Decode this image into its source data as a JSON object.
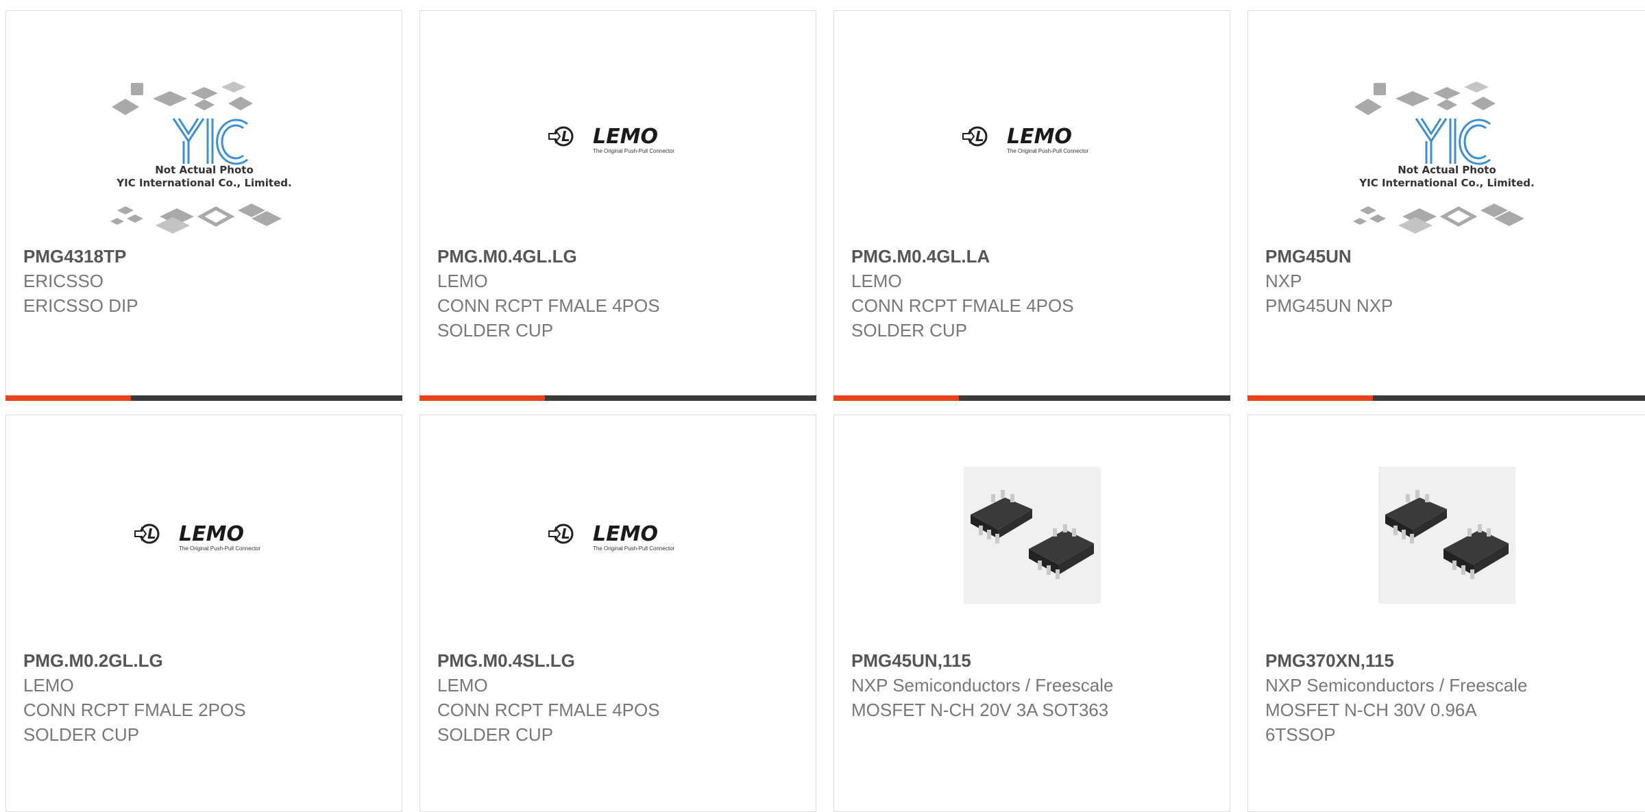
{
  "placeholder_photo": {
    "line1": "Not Actual Photo",
    "line2": "YIC International Co., Limited."
  },
  "lemo_logo": {
    "brand": "LEMO",
    "tagline": "The Original Push-Pull Connector"
  },
  "colors": {
    "accent": "#e8431c",
    "bar": "#3a3a3a",
    "border": "#dcdcdc"
  },
  "products": [
    {
      "part": "PMG4318TP",
      "manufacturer": "ERICSSO",
      "desc1": "ERICSSO DIP",
      "desc2": "",
      "image": "yic-placeholder"
    },
    {
      "part": "PMG.M0.4GL.LG",
      "manufacturer": "LEMO",
      "desc1": "CONN RCPT FMALE 4POS",
      "desc2": "SOLDER CUP",
      "image": "lemo-logo"
    },
    {
      "part": "PMG.M0.4GL.LA",
      "manufacturer": "LEMO",
      "desc1": "CONN RCPT FMALE 4POS",
      "desc2": "SOLDER CUP",
      "image": "lemo-logo"
    },
    {
      "part": "PMG45UN",
      "manufacturer": "NXP",
      "desc1": "PMG45UN NXP",
      "desc2": "",
      "image": "yic-placeholder"
    },
    {
      "part": "PMG.M0.2GL.LG",
      "manufacturer": "LEMO",
      "desc1": "CONN RCPT FMALE 2POS",
      "desc2": "SOLDER CUP",
      "image": "lemo-logo"
    },
    {
      "part": "PMG.M0.4SL.LG",
      "manufacturer": "LEMO",
      "desc1": "CONN RCPT FMALE 4POS",
      "desc2": "SOLDER CUP",
      "image": "lemo-logo"
    },
    {
      "part": "PMG45UN,115",
      "manufacturer": "NXP Semiconductors / Freescale",
      "desc1": "MOSFET N-CH 20V 3A SOT363",
      "desc2": "",
      "image": "sot363-chips"
    },
    {
      "part": "PMG370XN,115",
      "manufacturer": "NXP Semiconductors / Freescale",
      "desc1": "MOSFET N-CH 30V 0.96A",
      "desc2": "6TSSOP",
      "image": "sot363-chips"
    }
  ]
}
